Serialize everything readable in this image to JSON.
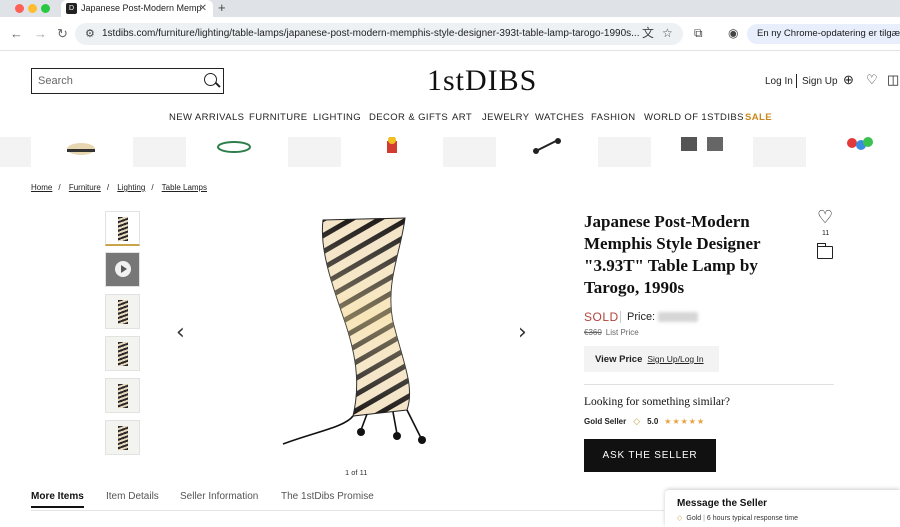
{
  "browser": {
    "tab_title": "Japanese Post-Modern Memp",
    "favicon_text": "D",
    "url": "1stdibs.com/furniture/lighting/table-lamps/japanese-post-modern-memphis-style-designer-393t-table-lamp-tarogo-1990s...",
    "update_notice": "En ny Chrome-opdatering er tilgængelig"
  },
  "header": {
    "search_placeholder": "Search",
    "logo": "1stDIBS",
    "login": "Log In",
    "signup": "Sign Up"
  },
  "nav": {
    "items": [
      "NEW ARRIVALS",
      "FURNITURE",
      "LIGHTING",
      "DECOR & GIFTS",
      "ART",
      "JEWELRY",
      "WATCHES",
      "FASHION",
      "WORLD OF 1STDIBS",
      "SALE"
    ],
    "sale_color": "#c9871b"
  },
  "breadcrumb": [
    "Home",
    "Furniture",
    "Lighting",
    "Table Lamps"
  ],
  "gallery": {
    "counter": "1 of 11"
  },
  "product": {
    "title": "Japanese Post-Modern Memphis Style Designer \"3.93T\" Table Lamp by Tarogo, 1990s",
    "favorites_count": "11",
    "status": "SOLD",
    "price_label": "Price:",
    "list_price_value": "€360",
    "list_price_label": "List Price",
    "view_price_label": "View Price",
    "signup_login": "Sign Up/Log In",
    "looking_similar": "Looking for something similar?",
    "seller_tier": "Gold Seller",
    "rating": "5.0",
    "stars": "★★★★★",
    "ask_button": "ASK THE SELLER"
  },
  "bottom_tabs": [
    "More Items",
    "Item Details",
    "Seller Information",
    "The 1stDibs Promise"
  ],
  "message_panel": {
    "title": "Message the Seller",
    "tier": "Gold",
    "response": "6 hours typical response time"
  },
  "colors": {
    "sold": "#b2433a",
    "gold": "#c9a44a",
    "stars": "#e9a23b"
  }
}
